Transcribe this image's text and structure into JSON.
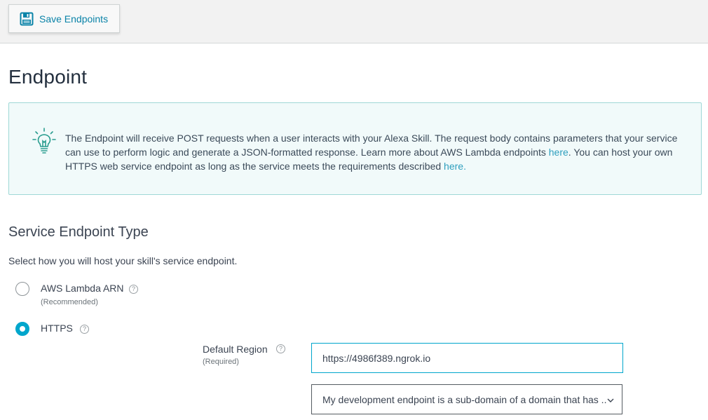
{
  "toolbar": {
    "save_label": "Save Endpoints",
    "save_icon": "floppy-disk-icon"
  },
  "page": {
    "title": "Endpoint"
  },
  "info": {
    "icon": "lightbulb-icon",
    "text_part1": "The Endpoint will receive POST requests when a user interacts with your Alexa Skill. The request body contains parameters that your service can use to perform logic and generate a JSON-formatted response. Learn more about AWS Lambda endpoints ",
    "link1": "here",
    "text_part2": ". You can host your own HTTPS web service endpoint as long as the service meets the requirements described ",
    "link2": "here."
  },
  "service_endpoint": {
    "title": "Service Endpoint Type",
    "instruction": "Select how you will host your skill's service endpoint.",
    "options": [
      {
        "label": "AWS Lambda ARN",
        "sublabel": "(Recommended)",
        "selected": false
      },
      {
        "label": "HTTPS",
        "selected": true
      }
    ],
    "help_glyph": "?"
  },
  "default_region": {
    "label": "Default Region",
    "sublabel": "(Required)",
    "url_value": "https://4986f389.ngrok.io",
    "certificate_option": "My development endpoint is a sub-domain of a domain that has ..."
  },
  "colors": {
    "accent": "#00a6cc",
    "link": "#2e9fbe",
    "info_bg": "#f1fafa",
    "info_border": "#9fd8d6",
    "toolbar_bg": "#f2f2f2"
  }
}
